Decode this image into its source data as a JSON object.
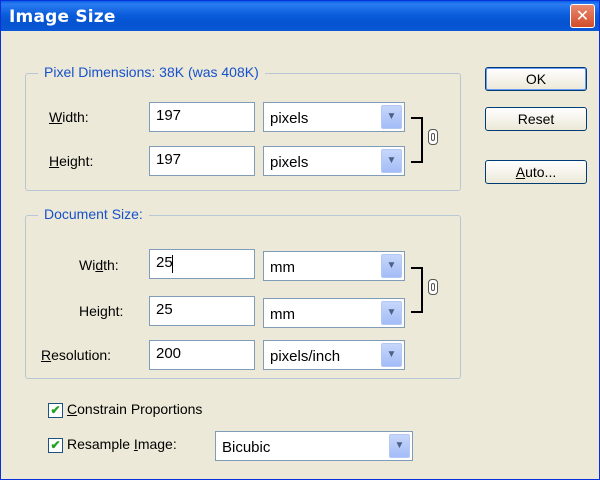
{
  "window": {
    "title": "Image Size",
    "close_glyph": "✕"
  },
  "pixel_dimensions": {
    "legend": "Pixel Dimensions:  38K (was 408K)",
    "width_label_u": "W",
    "width_label_rest": "idth:",
    "width_value": "197",
    "width_unit": "pixels",
    "height_label_u": "H",
    "height_label_rest": "eight:",
    "height_value": "197",
    "height_unit": "pixels"
  },
  "document_size": {
    "legend": "Document Size:",
    "width_label_a": "Wi",
    "width_label_u": "d",
    "width_label_b": "th:",
    "width_value": "25",
    "width_unit": "mm",
    "height_label_a": "Hei",
    "height_label_u": "g",
    "height_label_b": "ht:",
    "height_value": "25",
    "height_unit": "mm",
    "resolution_label_u": "R",
    "resolution_label_rest": "esolution:",
    "resolution_value": "200",
    "resolution_unit": "pixels/inch"
  },
  "options": {
    "constrain_u": "C",
    "constrain_rest": "onstrain Proportions",
    "constrain_checked": true,
    "resample_a": "Resample ",
    "resample_u": "I",
    "resample_b": "mage:",
    "resample_checked": true,
    "resample_method": "Bicubic"
  },
  "buttons": {
    "ok": "OK",
    "reset": "Reset",
    "auto_u": "A",
    "auto_rest": "uto..."
  },
  "colors": {
    "accent": "#1751cc",
    "titlebar": "#0553d0"
  },
  "icons": {
    "dropdown": "▼",
    "check": "✔",
    "link": "chain-link-icon"
  }
}
